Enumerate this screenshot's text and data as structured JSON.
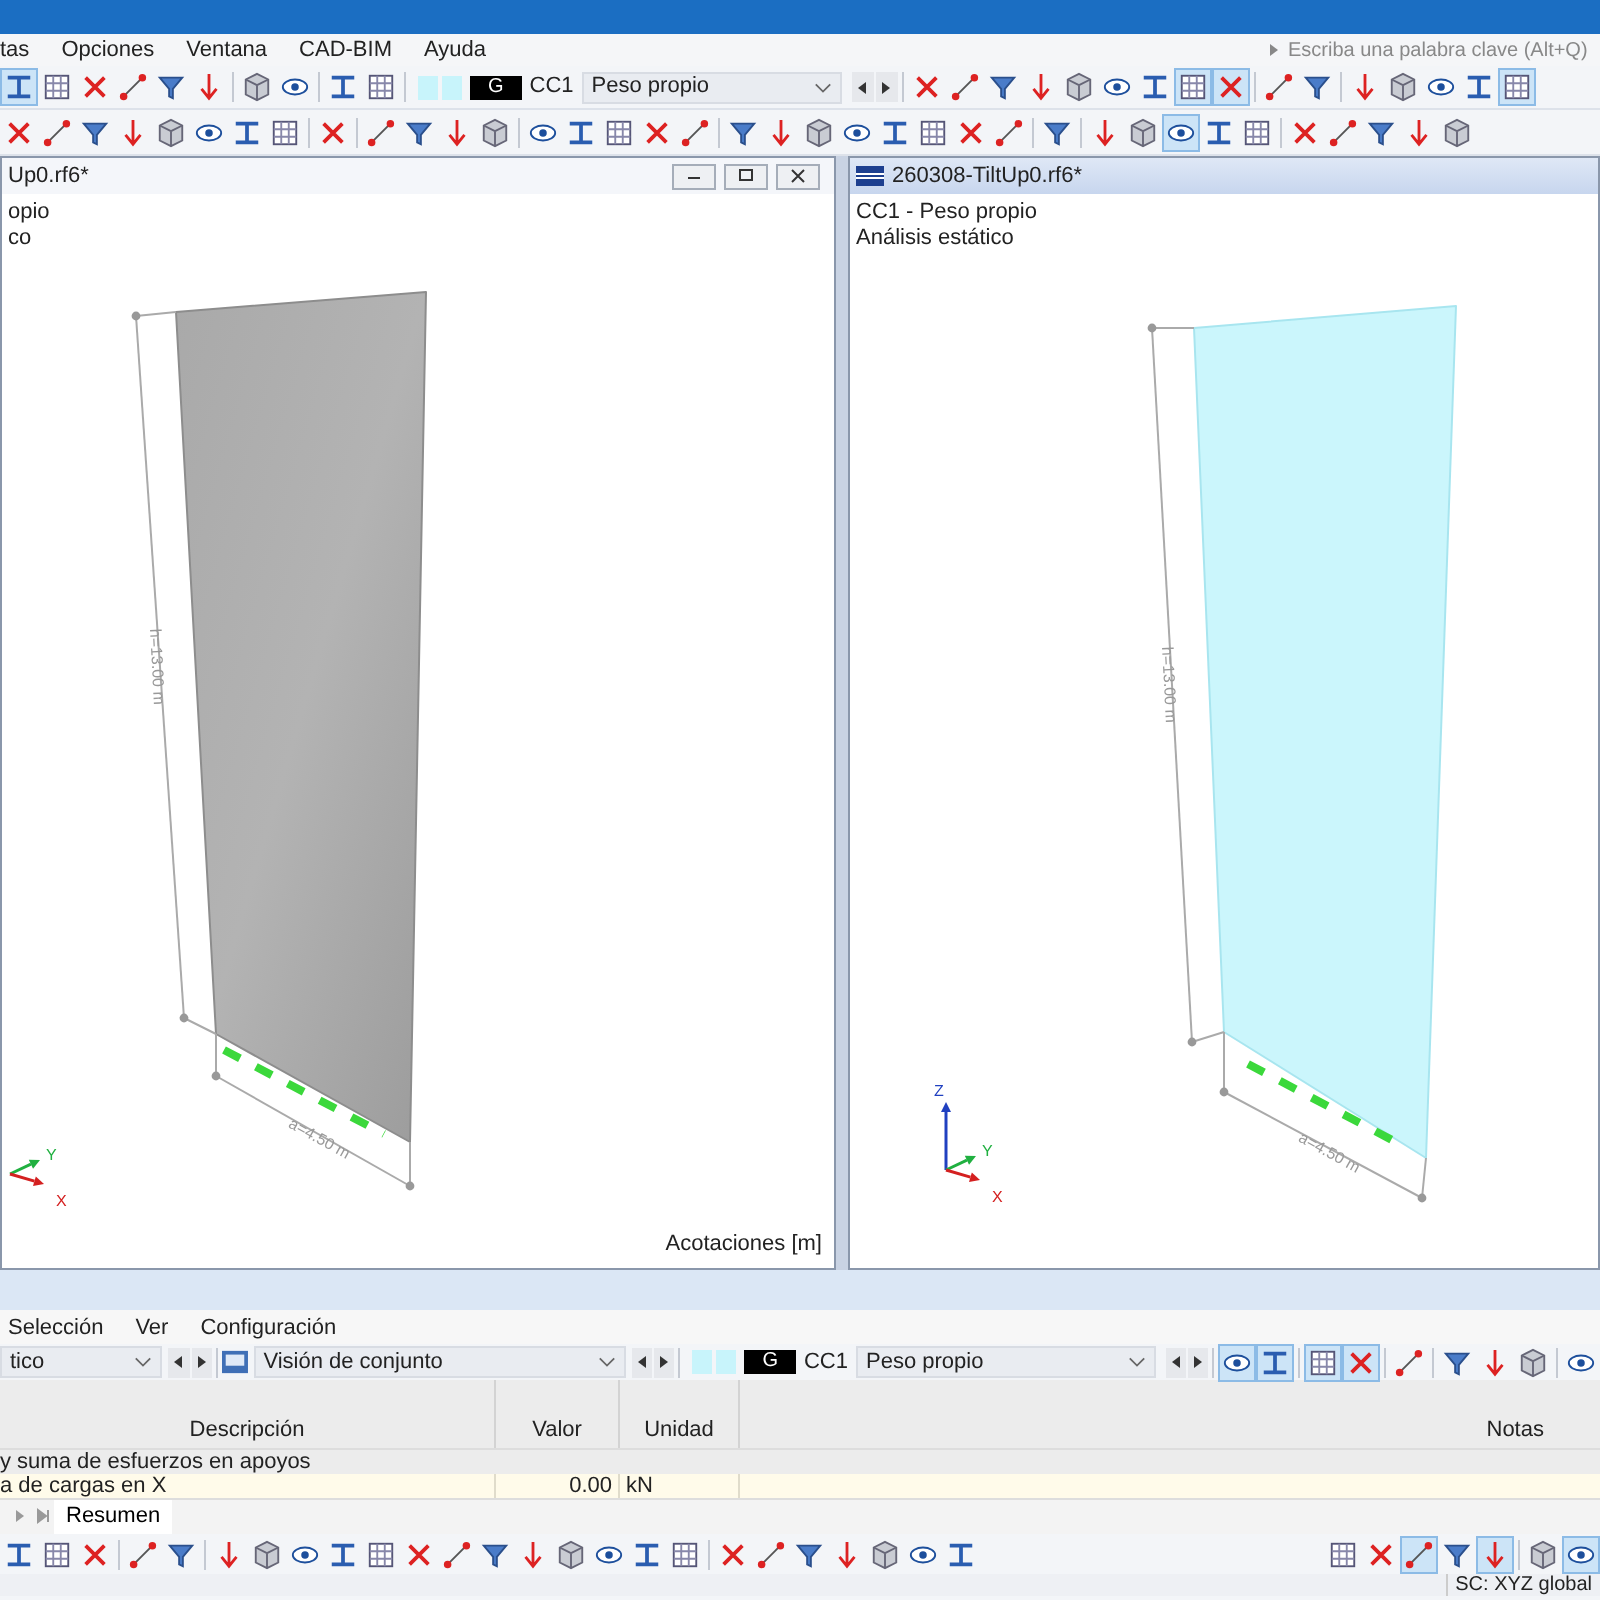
{
  "menu": [
    "tas",
    "Opciones",
    "Ventana",
    "CAD-BIM",
    "Ayuda"
  ],
  "search": {
    "placeholder": "Escriba una palabra clave (Alt+Q)"
  },
  "toolbar_1": {
    "groups_left": [
      [
        {
          "selected": true
        },
        {
          "selected": false
        },
        {
          "selected": false
        },
        {
          "selected": false
        },
        {
          "selected": false
        },
        {
          "selected": false
        }
      ],
      [
        {
          "selected": false
        },
        {
          "selected": false
        }
      ],
      [
        {
          "selected": false
        },
        {
          "selected": false
        }
      ]
    ],
    "load_case": {
      "tag": "G",
      "code": "CC1",
      "name": "Peso propio"
    },
    "groups_right": [
      [
        {
          "selected": false
        },
        {
          "selected": false
        },
        {
          "selected": false
        },
        {
          "selected": false
        },
        {
          "selected": false
        },
        {
          "selected": false
        },
        {
          "selected": false
        },
        {
          "selected": true
        },
        {
          "selected": true
        }
      ],
      [
        {
          "selected": false
        },
        {
          "selected": false
        }
      ],
      [
        {
          "selected": false
        },
        {
          "selected": false
        },
        {
          "selected": false
        },
        {
          "selected": false
        },
        {
          "selected": true
        }
      ]
    ]
  },
  "toolbar_2": {
    "groups": [
      [
        {
          "selected": false
        },
        {
          "selected": false
        },
        {
          "selected": false
        },
        {
          "selected": false
        },
        {
          "selected": false
        },
        {
          "selected": false
        },
        {
          "selected": false
        },
        {
          "selected": false
        }
      ],
      [
        {
          "selected": false
        }
      ],
      [
        {
          "selected": false
        },
        {
          "selected": false
        },
        {
          "selected": false
        },
        {
          "selected": false
        }
      ],
      [
        {
          "selected": false
        },
        {
          "selected": false
        },
        {
          "selected": false
        },
        {
          "selected": false
        },
        {
          "selected": false
        }
      ],
      [
        {
          "selected": false
        },
        {
          "selected": false
        },
        {
          "selected": false
        },
        {
          "selected": false
        },
        {
          "selected": false
        },
        {
          "selected": false
        },
        {
          "selected": false
        },
        {
          "selected": false
        }
      ],
      [
        {
          "selected": false
        }
      ],
      [
        {
          "selected": false
        },
        {
          "selected": false
        },
        {
          "selected": true
        },
        {
          "selected": false
        },
        {
          "selected": false
        }
      ],
      [
        {
          "selected": false
        },
        {
          "selected": false
        },
        {
          "selected": false
        },
        {
          "selected": false
        },
        {
          "selected": false
        }
      ]
    ]
  },
  "views": [
    {
      "title": "Up0.rf6*",
      "active": false,
      "kind": "solid",
      "info": [
        "opio",
        "co"
      ],
      "height_label": "h=13.00 m",
      "width_label": "a=4.50 m",
      "axes": [
        {
          "kind": "y",
          "label": "Y"
        },
        {
          "kind": "x",
          "label": "X"
        }
      ],
      "footer": "Acotaciones [m]"
    },
    {
      "title": "260308-TiltUp0.rf6*",
      "active": true,
      "kind": "translucent",
      "info": [
        "CC1 - Peso propio",
        "Análisis estático"
      ],
      "height_label": "h=13.00 m",
      "width_label": "a=4.50 m",
      "axes": [
        {
          "kind": "z",
          "label": "Z"
        },
        {
          "kind": "y",
          "label": "Y"
        },
        {
          "kind": "x",
          "label": "X"
        }
      ]
    }
  ],
  "panel": {
    "menu": [
      "Selección",
      "Ver",
      "Configuración"
    ],
    "analysis_combo": "tico",
    "table_combo": "Visión de conjunto",
    "load_case": {
      "tag": "G",
      "code": "CC1",
      "name": "Peso propio"
    },
    "buttons": [
      [
        {
          "selected": true
        },
        {
          "selected": true
        }
      ],
      [
        {
          "selected": true
        },
        {
          "selected": true
        }
      ],
      [
        {
          "selected": false
        }
      ],
      [
        {
          "selected": false
        },
        {
          "selected": false
        },
        {
          "selected": false
        }
      ],
      [
        {
          "selected": false
        }
      ]
    ],
    "table": {
      "columns": [
        "Descripción",
        "Valor",
        "Unidad",
        "Notas"
      ],
      "group": "y suma de esfuerzos en apoyos",
      "rows": [
        {
          "description": "a de cargas en X",
          "value": "0.00",
          "unit": "kN"
        }
      ]
    },
    "tabs": [
      {
        "label": "Resumen",
        "selected": true
      }
    ],
    "toolbar": {
      "groups_left": [
        [
          {
            "selected": false
          },
          {
            "selected": false
          },
          {
            "selected": false
          }
        ],
        [
          {
            "selected": false
          },
          {
            "selected": false
          }
        ],
        [
          {
            "selected": false
          },
          {
            "selected": false
          },
          {
            "selected": false
          },
          {
            "selected": false
          },
          {
            "selected": false
          },
          {
            "selected": false
          },
          {
            "selected": false
          },
          {
            "selected": false
          },
          {
            "selected": false
          },
          {
            "selected": false
          },
          {
            "selected": false
          },
          {
            "selected": false
          },
          {
            "selected": false
          }
        ],
        [
          {
            "selected": false
          },
          {
            "selected": false
          },
          {
            "selected": false
          },
          {
            "selected": false
          },
          {
            "selected": false
          },
          {
            "selected": false
          },
          {
            "selected": false
          }
        ]
      ],
      "groups_right": [
        [
          {
            "selected": false
          },
          {
            "selected": false
          },
          {
            "selected": true
          },
          {
            "selected": false
          },
          {
            "selected": true
          }
        ],
        [
          {
            "selected": false
          },
          {
            "selected": true
          }
        ]
      ]
    }
  },
  "status_bar": {
    "coordinate_system": "SC: XYZ global"
  }
}
